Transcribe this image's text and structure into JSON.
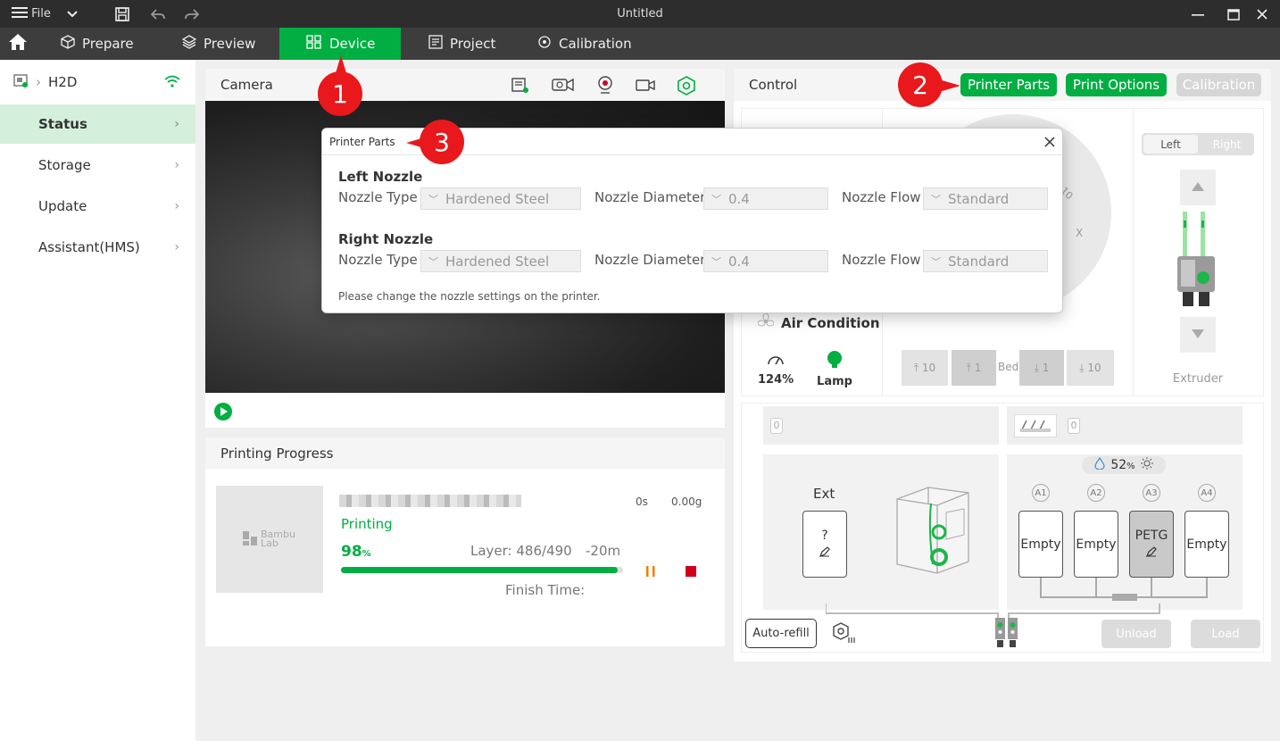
{
  "window": {
    "title": "Untitled",
    "file_label": "File"
  },
  "nav": {
    "tabs": [
      {
        "label": "Prepare"
      },
      {
        "label": "Preview"
      },
      {
        "label": "Device"
      },
      {
        "label": "Project"
      },
      {
        "label": "Calibration"
      }
    ]
  },
  "sidebar": {
    "printer_name": "H2D",
    "items": [
      {
        "label": "Status"
      },
      {
        "label": "Storage"
      },
      {
        "label": "Update"
      },
      {
        "label": "Assistant(HMS)"
      }
    ]
  },
  "camera": {
    "title": "Camera"
  },
  "progress": {
    "title": "Printing Progress",
    "status": "Printing",
    "percent": "98",
    "percent_unit": "%",
    "percent_value": 0.98,
    "layer": "Layer: 486/490",
    "remaining": "-20m",
    "time_used": "0s",
    "weight": "0.00g",
    "finish_time": "Finish Time:",
    "thumb_text": "Bambu Lab"
  },
  "control": {
    "title": "Control",
    "buttons": {
      "printer_parts": "Printer Parts",
      "print_options": "Print Options",
      "calibration": "Calibration"
    },
    "air_condition": "Air Condition",
    "speed": "124%",
    "lamp": "Lamp",
    "bed_label": "Bed",
    "bed_steps": [
      "10",
      "1",
      "1",
      "10"
    ],
    "dial_labels": [
      "10",
      "X"
    ],
    "extruder": {
      "label": "Extruder",
      "left": "Left",
      "right": "Right"
    },
    "zero_left": "0",
    "zero_right": "0",
    "ext": {
      "label": "Ext",
      "slot": "?"
    },
    "humidity": "52",
    "humidity_unit": "%",
    "ams_labels": [
      "A1",
      "A2",
      "A3",
      "A4"
    ],
    "ams_slots": [
      "Empty",
      "Empty",
      "PETG",
      "Empty"
    ],
    "auto_refill": "Auto-refill",
    "unload": "Unload",
    "load": "Load"
  },
  "dialog": {
    "title": "Printer Parts",
    "left_nozzle": {
      "heading": "Left Nozzle",
      "type_label": "Nozzle Type",
      "type": "Hardened Steel",
      "diameter_label": "Nozzle Diameter",
      "diameter": "0.4",
      "flow_label": "Nozzle Flow",
      "flow": "Standard"
    },
    "right_nozzle": {
      "heading": "Right Nozzle",
      "type_label": "Nozzle Type",
      "type": "Hardened Steel",
      "diameter_label": "Nozzle Diameter",
      "diameter": "0.4",
      "flow_label": "Nozzle Flow",
      "flow": "Standard"
    },
    "note": "Please change the nozzle settings on the printer."
  },
  "annotations": [
    "1",
    "2",
    "3"
  ],
  "colors": {
    "accent": "#00ae42",
    "badge": "#e8181c",
    "stop": "#d0021b",
    "pause": "#f57c00"
  }
}
